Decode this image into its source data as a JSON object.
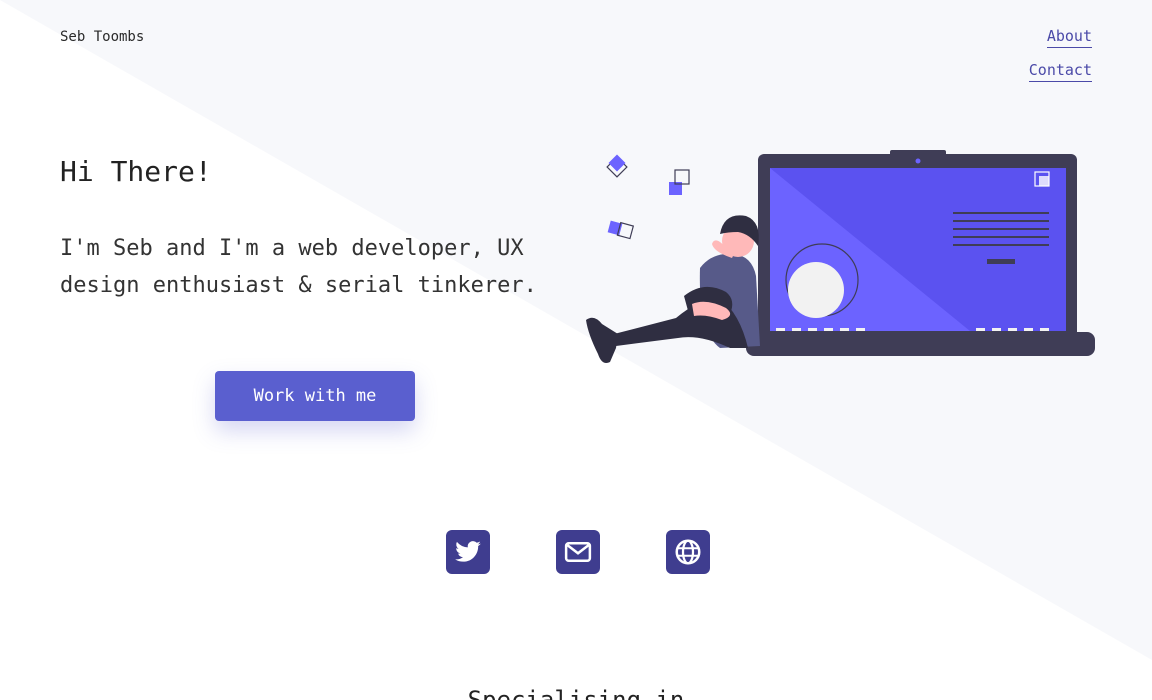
{
  "header": {
    "brand": "Seb Toombs",
    "nav": [
      {
        "label": "About"
      },
      {
        "label": "Contact"
      }
    ]
  },
  "hero": {
    "title": "Hi There!",
    "intro": "I'm Seb and I'm a web developer, UX design enthusiast & serial tinkerer.",
    "cta_label": "Work with me"
  },
  "socials": [
    {
      "icon": "twitter-icon"
    },
    {
      "icon": "envelope-icon"
    },
    {
      "icon": "globe-icon"
    }
  ],
  "specialising": {
    "heading": "Specialising in"
  },
  "colors": {
    "accent": "#5a5fcf",
    "accent_dark": "#3f3d8f",
    "illustration_primary": "#6c63ff",
    "background_tint": "#f7f8fb"
  }
}
